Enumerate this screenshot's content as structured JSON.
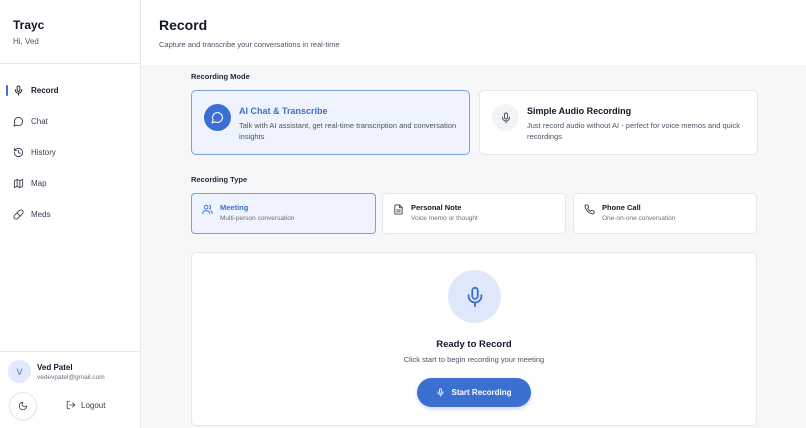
{
  "app": {
    "name": "Trayc",
    "greeting": "Hi, Ved"
  },
  "sidebar": {
    "items": [
      {
        "label": "Record",
        "icon": "mic-icon",
        "active": true
      },
      {
        "label": "Chat",
        "icon": "chat-bubble-icon",
        "active": false
      },
      {
        "label": "History",
        "icon": "history-icon",
        "active": false
      },
      {
        "label": "Map",
        "icon": "map-icon",
        "active": false
      },
      {
        "label": "Meds",
        "icon": "pill-icon",
        "active": false
      }
    ]
  },
  "user": {
    "initial": "V",
    "name": "Ved Patel",
    "email": "vedevpatel@gmail.com"
  },
  "footer": {
    "logout_label": "Logout",
    "theme_icon": "moon-icon"
  },
  "header": {
    "title": "Record",
    "subtitle": "Capture and transcribe your conversations in real-time"
  },
  "recording_mode": {
    "label": "Recording Mode",
    "options": [
      {
        "title": "AI Chat & Transcribe",
        "description": "Talk with AI assistant, get real-time transcription and conversation insights",
        "icon": "chat-bubble-icon",
        "selected": true
      },
      {
        "title": "Simple Audio Recording",
        "description": "Just record audio without AI - perfect for voice memos and quick recordings",
        "icon": "mic-icon",
        "selected": false
      }
    ]
  },
  "recording_type": {
    "label": "Recording Type",
    "options": [
      {
        "title": "Meeting",
        "description": "Multi-person conversation",
        "icon": "users-icon",
        "selected": true
      },
      {
        "title": "Personal Note",
        "description": "Voice memo or thought",
        "icon": "document-icon",
        "selected": false
      },
      {
        "title": "Phone Call",
        "description": "One-on-one conversation",
        "icon": "phone-icon",
        "selected": false
      }
    ]
  },
  "recorder": {
    "status_title": "Ready to Record",
    "status_subtitle": "Click start to begin recording your meeting",
    "start_label": "Start Recording"
  },
  "colors": {
    "accent": "#3b6fd1",
    "accent_light": "#eef3fd",
    "selected_border": "#7d9fe2"
  }
}
